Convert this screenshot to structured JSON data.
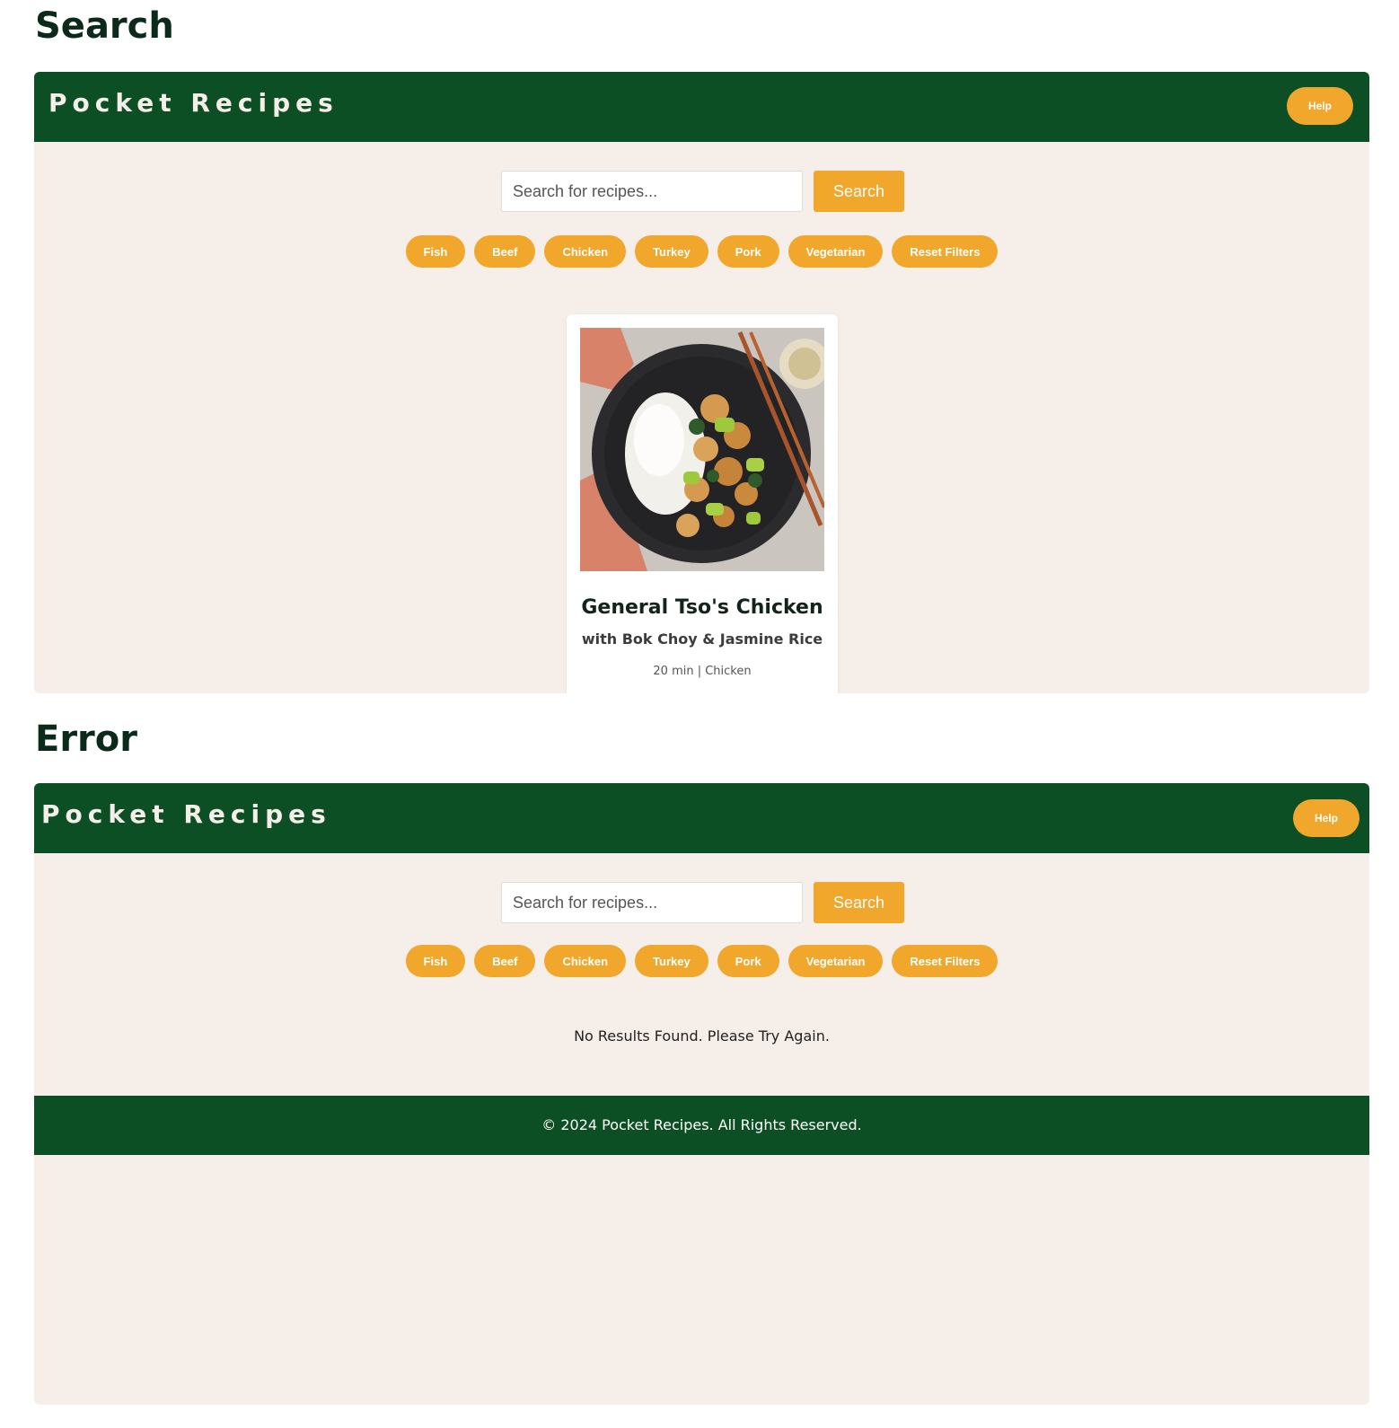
{
  "sections": {
    "search_title": "Search",
    "error_title": "Error"
  },
  "header": {
    "brand": "Pocket Recipes",
    "help_label": "Help"
  },
  "search": {
    "placeholder": "Search for recipes...",
    "button_label": "Search"
  },
  "filters": [
    "Fish",
    "Beef",
    "Chicken",
    "Turkey",
    "Pork",
    "Vegetarian",
    "Reset Filters"
  ],
  "recipe_card": {
    "title": "General Tso's Chicken",
    "subtitle": "with Bok Choy & Jasmine Rice",
    "meta": "20 min | Chicken",
    "image_icon": "food-photo"
  },
  "error": {
    "message": "No Results Found. Please Try Again."
  },
  "footer": {
    "copyright": "© 2024 Pocket Recipes. All Rights Reserved."
  },
  "colors": {
    "header_green": "#0d4f25",
    "accent_orange": "#f0a72c",
    "page_bg": "#f6eee9"
  }
}
